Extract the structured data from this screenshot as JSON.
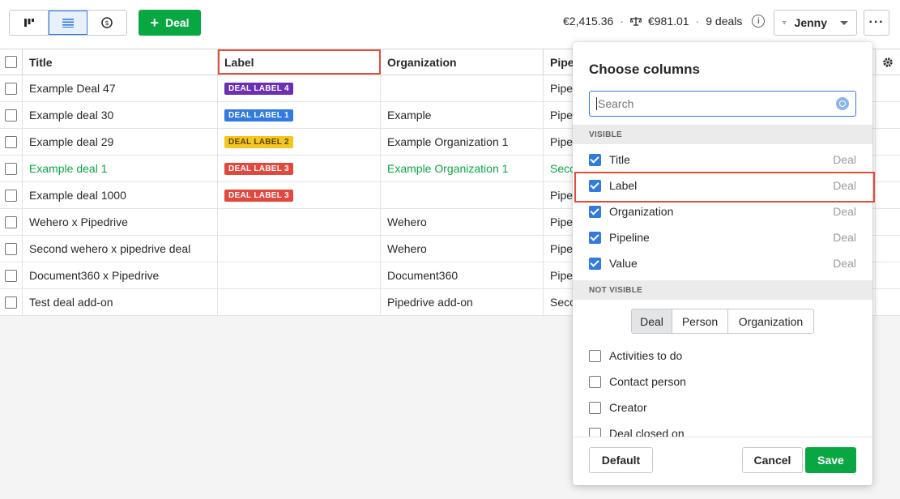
{
  "toolbar": {
    "add_deal_label": "Deal",
    "summary_value": "€2,415.36",
    "summary_weighted": "€981.01",
    "summary_count": "9 deals",
    "filter_label": "Jenny",
    "more_label": "···"
  },
  "table": {
    "headers": [
      "Title",
      "Label",
      "Organization",
      "Pipe"
    ],
    "rows": [
      {
        "title": "Example Deal 47",
        "label": "DEAL LABEL 4",
        "label_color": "#6b2fb3",
        "org": "",
        "pipe": "Pipe"
      },
      {
        "title": "Example deal 30",
        "label": "DEAL LABEL 1",
        "label_color": "#317ae2",
        "org": "Example",
        "pipe": "Pipe"
      },
      {
        "title": "Example deal 29",
        "label": "DEAL LABEL 2",
        "label_color": "#f5c61f",
        "org": "Example Organization 1",
        "pipe": "Pipe"
      },
      {
        "title": "Example deal 1",
        "label": "DEAL LABEL 3",
        "label_color": "#e2483d",
        "org": "Example Organization 1",
        "pipe": "Seco"
      },
      {
        "title": "Example deal 1000",
        "label": "DEAL LABEL 3",
        "label_color": "#e2483d",
        "org": "",
        "pipe": "Pipe"
      },
      {
        "title": "Wehero x Pipedrive",
        "label": "",
        "label_color": "",
        "org": "Wehero",
        "pipe": "Pipe"
      },
      {
        "title": "Second wehero x pipedrive deal",
        "label": "",
        "label_color": "",
        "org": "Wehero",
        "pipe": "Pipe"
      },
      {
        "title": "Document360 x Pipedrive",
        "label": "",
        "label_color": "",
        "org": "Document360",
        "pipe": "Pipe"
      },
      {
        "title": "Test deal add-on",
        "label": "",
        "label_color": "",
        "org": "Pipedrive add-on",
        "pipe": "Seco"
      }
    ]
  },
  "panel": {
    "title": "Choose columns",
    "search_placeholder": "Search",
    "visible_heading": "VISIBLE",
    "visible": [
      {
        "name": "Title",
        "type": "Deal"
      },
      {
        "name": "Label",
        "type": "Deal"
      },
      {
        "name": "Organization",
        "type": "Deal"
      },
      {
        "name": "Pipeline",
        "type": "Deal"
      },
      {
        "name": "Value",
        "type": "Deal"
      }
    ],
    "not_visible_heading": "NOT VISIBLE",
    "tabs": [
      "Deal",
      "Person",
      "Organization"
    ],
    "not_visible": [
      "Activities to do",
      "Contact person",
      "Creator",
      "Deal closed on"
    ],
    "buttons": {
      "default": "Default",
      "cancel": "Cancel",
      "save": "Save"
    }
  },
  "colors": {
    "accent": "#08a742",
    "primary": "#317ae2",
    "highlight": "#e24c38"
  }
}
